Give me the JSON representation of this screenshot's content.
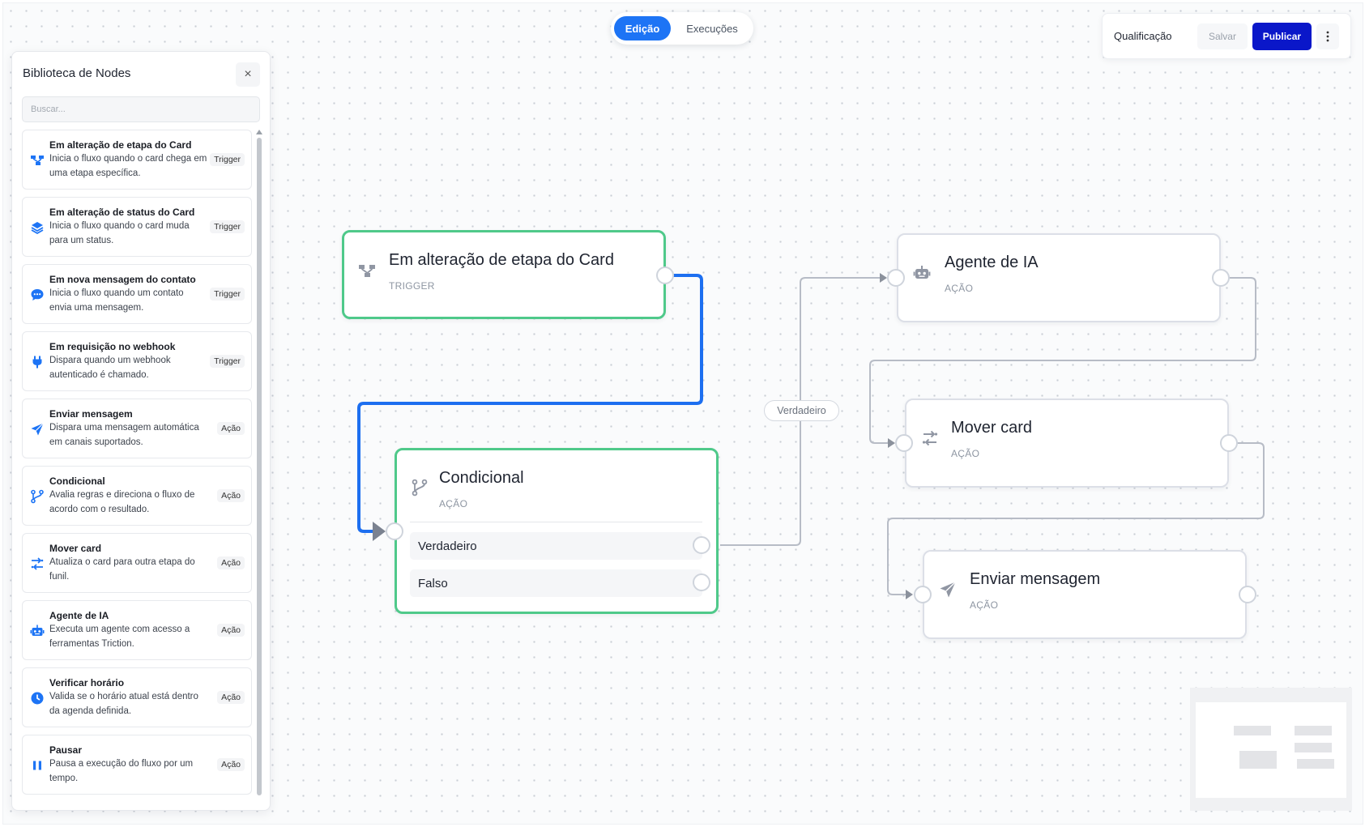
{
  "top_switch": {
    "edit_label": "Edição",
    "exec_label": "Execuções"
  },
  "toolbar": {
    "flow_name": "Qualificação",
    "save_label": "Salvar",
    "publish_label": "Publicar",
    "more_icon": "more-vertical-icon"
  },
  "library": {
    "title": "Biblioteca de Nodes",
    "search_placeholder": "Buscar...",
    "items": [
      {
        "name": "Em alteração de etapa do Card",
        "desc": "Inicia o fluxo quando o card chega em uma etapa específica.",
        "badge": "Trigger",
        "icon": "stage-change-icon"
      },
      {
        "name": "Em alteração de status do Card",
        "desc": "Inicia o fluxo quando o card muda para um status.",
        "badge": "Trigger",
        "icon": "layers-icon"
      },
      {
        "name": "Em nova mensagem do contato",
        "desc": "Inicia o fluxo quando um contato envia uma mensagem.",
        "badge": "Trigger",
        "icon": "chat-bubble-icon"
      },
      {
        "name": "Em requisição no webhook",
        "desc": "Dispara quando um webhook autenticado é chamado.",
        "badge": "Trigger",
        "icon": "plug-icon"
      },
      {
        "name": "Enviar mensagem",
        "desc": "Dispara uma mensagem automática em canais suportados.",
        "badge": "Ação",
        "icon": "send-icon"
      },
      {
        "name": "Condicional",
        "desc": "Avalia regras e direciona o fluxo de acordo com o resultado.",
        "badge": "Ação",
        "icon": "git-branch-icon"
      },
      {
        "name": "Mover card",
        "desc": "Atualiza o card para outra etapa do funil.",
        "badge": "Ação",
        "icon": "move-arrows-icon"
      },
      {
        "name": "Agente de IA",
        "desc": "Executa um agente com acesso a ferramentas Triction.",
        "badge": "Ação",
        "icon": "robot-icon"
      },
      {
        "name": "Verificar horário",
        "desc": "Valida se o horário atual está dentro da agenda definida.",
        "badge": "Ação",
        "icon": "clock-icon"
      },
      {
        "name": "Pausar",
        "desc": "Pausa a execução do fluxo por um tempo.",
        "badge": "Ação",
        "icon": "pause-icon"
      }
    ]
  },
  "flow": {
    "nodes": {
      "trigger": {
        "title": "Em alteração de etapa do Card",
        "subtitle": "TRIGGER"
      },
      "conditional": {
        "title": "Condicional",
        "subtitle": "AÇÃO",
        "branches": [
          "Verdadeiro",
          "Falso"
        ]
      },
      "ai_agent": {
        "title": "Agente de IA",
        "subtitle": "AÇÃO"
      },
      "move_card": {
        "title": "Mover card",
        "subtitle": "AÇÃO"
      },
      "send_message": {
        "title": "Enviar mensagem",
        "subtitle": "AÇÃO"
      }
    },
    "edge_label": "Verdadeiro"
  },
  "colors": {
    "accent_blue": "#1d74f5",
    "publish": "#0a17c9",
    "selected_border": "#4fc98a",
    "edge_active": "#1d6ff0",
    "edge_default": "#b7bcc6"
  }
}
